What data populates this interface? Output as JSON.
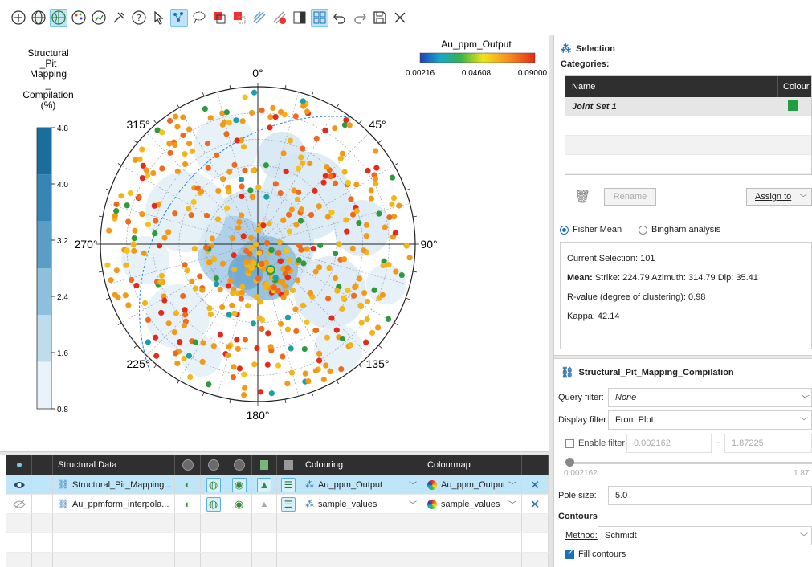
{
  "toolbar": {
    "icons": [
      "add-icon",
      "globe-icon",
      "stereonet-icon",
      "palette-icon",
      "chart-icon",
      "tools-icon",
      "help-icon",
      "pointer-icon",
      "select-points-icon",
      "lasso-icon",
      "fill-select-icon",
      "clear-select-icon",
      "stripes-icon",
      "erase-icon",
      "contrast-icon",
      "grid-icon",
      "undo-icon",
      "redo-icon",
      "save-icon",
      "close-icon"
    ]
  },
  "plot": {
    "legend_title_lines": [
      "Structural",
      "_Pit",
      "Mapping",
      "_",
      "Compilation",
      "(%)"
    ],
    "legend_ticks": [
      "4.8",
      "4.0",
      "3.2",
      "2.4",
      "1.6",
      "0.8"
    ],
    "legend_colors": [
      "#1a6e9e",
      "#3585b5",
      "#5a9ec7",
      "#8cc0dc",
      "#bfdcec",
      "#e9f3f9"
    ],
    "colorbar_title": "Au_ppm_Output",
    "colorbar_ticks": [
      "0.00216",
      "0.04608",
      "0.09000"
    ],
    "compass": {
      "n": "0°",
      "ne": "45°",
      "e": "90°",
      "se": "135°",
      "s": "180°",
      "sw": "225°",
      "w": "270°",
      "nw": "315°"
    }
  },
  "table": {
    "headers": {
      "structural_data": "Structural Data",
      "colouring": "Colouring",
      "colourmap": "Colourmap"
    },
    "rows": [
      {
        "name": "Structural_Pit_Mapping...",
        "colouring": "Au_ppm_Output",
        "colourmap": "Au_ppm_Output",
        "selected": true
      },
      {
        "name": "Au_ppmform_interpola...",
        "colouring": "sample_values",
        "colourmap": "sample_values",
        "selected": false
      }
    ]
  },
  "selection_panel": {
    "title": "Selection",
    "categories_label": "Categories:",
    "col_name": "Name",
    "col_colour": "Colour",
    "categories": [
      {
        "name": "Joint Set 1",
        "colour": "#1e9e3e"
      }
    ],
    "rename_label": "Rename",
    "assign_label": "Assign to",
    "fisher_label": "Fisher Mean",
    "bingham_label": "Bingham analysis",
    "current_selection": "Current Selection: 101",
    "mean_label": "Mean:",
    "mean_value": "Strike: 224.79 Azimuth: 314.79 Dip: 35.41",
    "r_value": "R-value (degree of clustering): 0.98",
    "kappa": "Kappa: 42.14"
  },
  "properties_panel": {
    "title": "Structural_Pit_Mapping_Compilation",
    "query_filter_label": "Query filter:",
    "query_filter_value": "None",
    "display_filter_label": "Display filter",
    "display_filter_value": "From Plot",
    "enable_filter_label": "Enable filter:",
    "filter_min": "0.002162",
    "filter_dash": "–",
    "filter_max": "1.87225",
    "slider_min": "0.002162",
    "slider_max": "1.87",
    "pole_size_label": "Pole size:",
    "pole_size_value": "5.0",
    "contours_label": "Contours",
    "method_label": "Method:",
    "method_value": "Schmidt",
    "fill_contours_label": "Fill contours"
  }
}
